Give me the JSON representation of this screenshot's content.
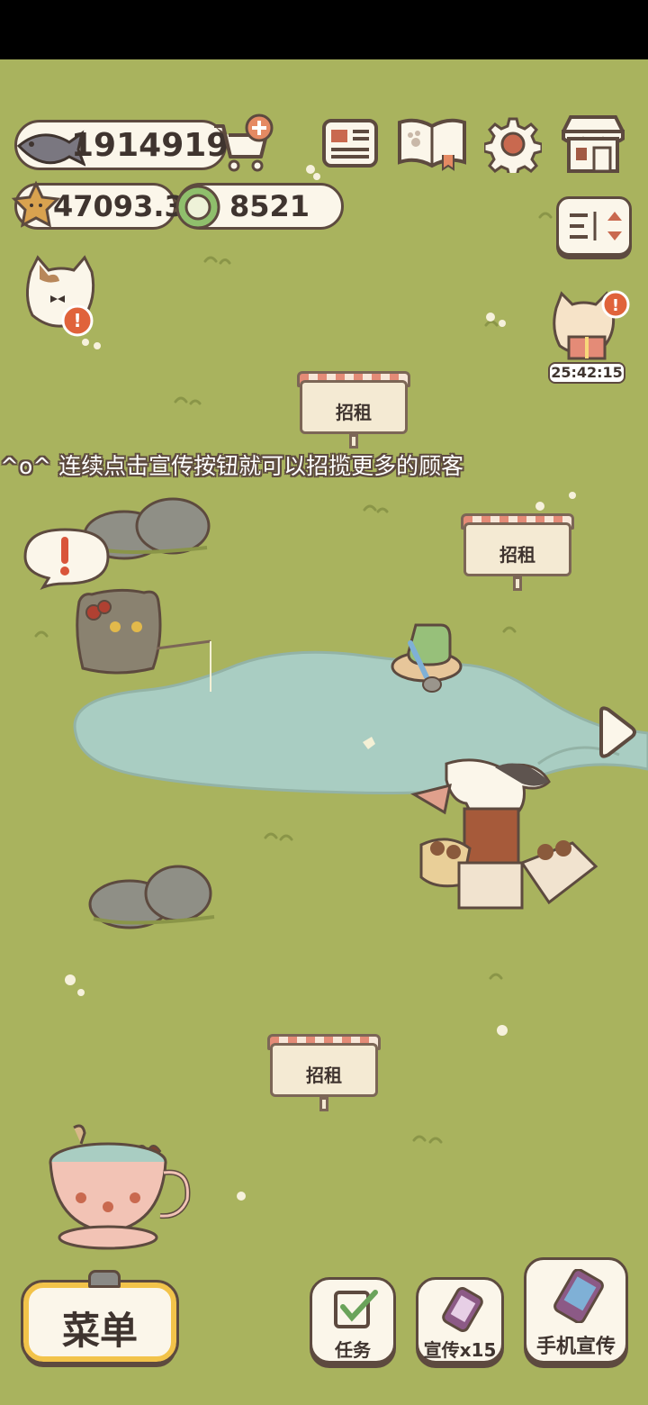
{
  "resources": {
    "fish": "1914919",
    "stars": "47093.3",
    "coins": "8521"
  },
  "signs": [
    "招租",
    "招租",
    "招租"
  ],
  "tip_text": "^o^ 连续点击宣传按钮就可以招揽更多的顾客",
  "timer": "25:42:15",
  "bottom": {
    "menu": "菜单",
    "tasks": "任务",
    "promote": "宣传x15",
    "phone_promote": "手机宣传"
  },
  "colors": {
    "grass": "#a9b35e",
    "pond": "#a9cdc2",
    "outline": "#5d4a3f",
    "panel": "#fbf6ea",
    "menu_border": "#f2c34a"
  }
}
